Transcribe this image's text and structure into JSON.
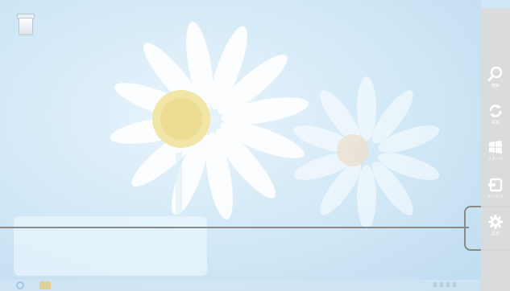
{
  "charms": {
    "search": {
      "icon": "search-icon",
      "label": "検索"
    },
    "share": {
      "icon": "share-icon",
      "label": "共有"
    },
    "start": {
      "icon": "windows-logo-icon",
      "label": "スタート"
    },
    "devices": {
      "icon": "devices-icon",
      "label": "デバイス"
    },
    "settings": {
      "icon": "gear-icon",
      "label": "設定"
    }
  },
  "colors": {
    "charms_bg": "#dadada",
    "charm_icon": "#ffffff",
    "callout": "#8a8a8a"
  }
}
